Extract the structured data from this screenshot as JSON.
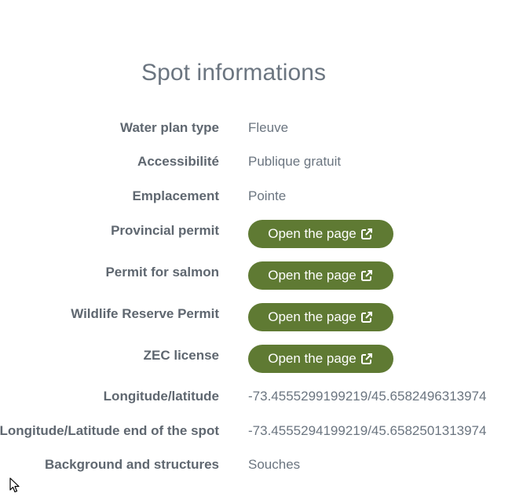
{
  "page": {
    "title": "Spot informations"
  },
  "rows": [
    {
      "label": "Water plan type",
      "value": "Fleuve"
    },
    {
      "label": "Accessibilité",
      "value": "Publique gratuit"
    },
    {
      "label": "Emplacement",
      "value": "Pointe"
    },
    {
      "label": "Provincial permit",
      "button": "Open the page"
    },
    {
      "label": "Permit for salmon",
      "button": "Open the page"
    },
    {
      "label": "Wildlife Reserve Permit",
      "button": "Open the page"
    },
    {
      "label": "ZEC license",
      "button": "Open the page"
    },
    {
      "label": "Longitude/latitude",
      "value": "-73.4555299199219/45.6582496313974"
    },
    {
      "label": "Longitude/Latitude end of the spot",
      "value": "-73.4555294199219/45.6582501313974"
    },
    {
      "label": "Background and structures",
      "value": "Souches"
    }
  ],
  "icons": {
    "external_link": "external-link-icon",
    "cursor": "mouse-pointer-icon"
  },
  "colors": {
    "button_bg": "#5f7a33",
    "label": "#5f6770",
    "value": "#6b7580"
  }
}
